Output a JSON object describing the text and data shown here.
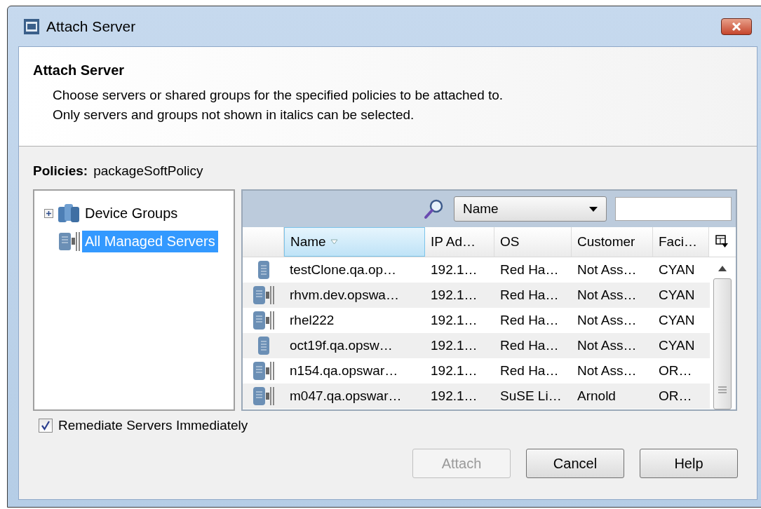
{
  "window": {
    "title": "Attach Server"
  },
  "header": {
    "title": "Attach Server",
    "lines": [
      "Choose servers or shared groups for the specified policies to be attached to.",
      "Only servers and groups not shown in italics can be selected."
    ]
  },
  "policies": {
    "label": "Policies:",
    "value": "packageSoftPolicy"
  },
  "tree": [
    {
      "label": "Device Groups",
      "kind": "groups",
      "expanded": false,
      "selected": false
    },
    {
      "label": "All Managed Servers",
      "kind": "managed",
      "selected": true
    }
  ],
  "search": {
    "field": "Name"
  },
  "table": {
    "columns": [
      {
        "label": "Name",
        "sorted": true
      },
      {
        "label": "IP Ad…",
        "sorted": false
      },
      {
        "label": "OS",
        "sorted": false
      },
      {
        "label": "Customer",
        "sorted": false
      },
      {
        "label": "Faci…",
        "sorted": false
      }
    ],
    "rows": [
      {
        "kind": "server",
        "cells": [
          "testClone.qa.op…",
          "192.1…",
          "Red Ha…",
          "Not Ass…",
          "CYAN"
        ]
      },
      {
        "kind": "managed",
        "cells": [
          "rhvm.dev.opswa…",
          "192.1…",
          "Red Ha…",
          "Not Ass…",
          "CYAN"
        ]
      },
      {
        "kind": "managed",
        "cells": [
          "rhel222",
          "192.1…",
          "Red Ha…",
          "Not Ass…",
          "CYAN"
        ]
      },
      {
        "kind": "server",
        "cells": [
          "oct19f.qa.opsw…",
          "192.1…",
          "Red Ha…",
          "Not Ass…",
          "CYAN"
        ]
      },
      {
        "kind": "managed",
        "cells": [
          "n154.qa.opswar…",
          "192.1…",
          "Red Ha…",
          "Not Ass…",
          "OR…"
        ]
      },
      {
        "kind": "managed",
        "cells": [
          "m047.qa.opswar…",
          "192.1…",
          "SuSE Li…",
          "Arnold",
          "OR…"
        ]
      }
    ]
  },
  "remediate": {
    "label": "Remediate Servers Immediately",
    "checked": true
  },
  "buttons": [
    {
      "label": "Attach",
      "disabled": true
    },
    {
      "label": "Cancel",
      "disabled": false
    },
    {
      "label": "Help",
      "disabled": false
    }
  ]
}
